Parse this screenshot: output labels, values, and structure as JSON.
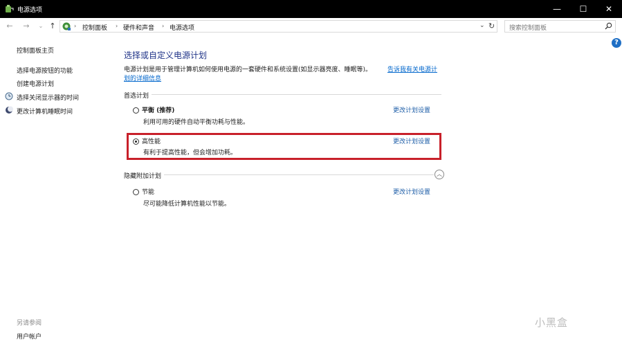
{
  "window": {
    "title": "电源选项",
    "minimize": "—",
    "maximize": "☐",
    "close": "✕"
  },
  "nav": {
    "back": "←",
    "forward": "→",
    "recent": "⌄",
    "up": "↑",
    "breadcrumbs": [
      "控制面板",
      "硬件和声音",
      "电源选项"
    ],
    "separator": "›",
    "dropdown": "⌄",
    "refresh": "↻",
    "search_placeholder": "搜索控制面板"
  },
  "help": "?",
  "sidebar": {
    "home": "控制面板主页",
    "items": [
      "选择电源按钮的功能",
      "创建电源计划",
      "选择关闭显示器的时间",
      "更改计算机睡眠时间"
    ],
    "see_also_label": "另请参阅",
    "see_also_items": [
      "用户帐户"
    ]
  },
  "main": {
    "title": "选择或自定义电源计划",
    "description": "电源计划是用于管理计算机如何使用电源的一套硬件和系统设置(如显示器亮度、睡眠等)。",
    "desc_link_1": "告诉我有关电源计",
    "desc_link_2": "划的详细信息",
    "preferred_label": "首选计划",
    "hidden_label": "隐藏附加计划",
    "collapse_symbol": "︿",
    "plans": [
      {
        "name": "平衡 (推荐)",
        "description": "利用可用的硬件自动平衡功耗与性能。",
        "link": "更改计划设置",
        "selected": false
      },
      {
        "name": "高性能",
        "description": "有利于提高性能，但会增加功耗。",
        "link": "更改计划设置",
        "selected": true
      },
      {
        "name": "节能",
        "description": "尽可能降低计算机性能以节能。",
        "link": "更改计划设置",
        "selected": false
      }
    ]
  },
  "watermark": "小黑盒",
  "colors": {
    "title_blue": "#1e3287",
    "link_blue": "#1f5fa8",
    "highlight_red": "#c8202a"
  }
}
